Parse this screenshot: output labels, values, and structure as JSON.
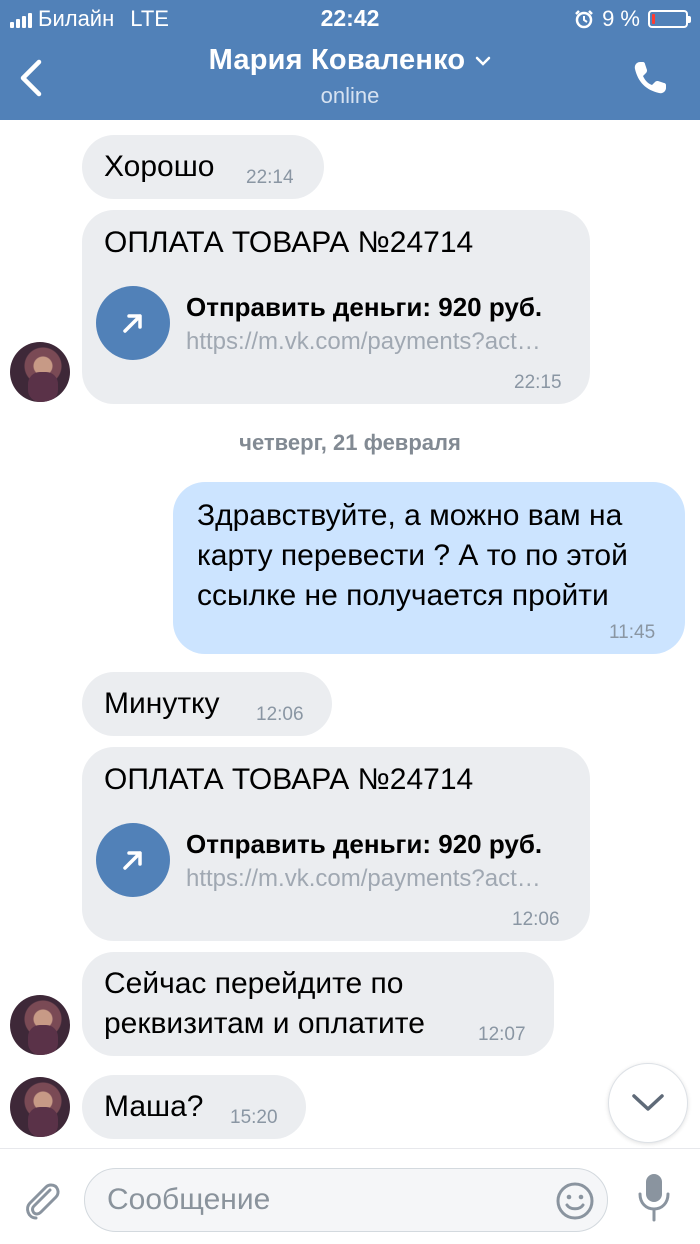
{
  "status_bar": {
    "carrier": "Билайн",
    "network": "LTE",
    "time": "22:42",
    "battery_percent": "9 %",
    "battery_level": 0.09
  },
  "header": {
    "title": "Мария Коваленко",
    "subtitle": "online"
  },
  "messages": [
    {
      "text": "Хорошо",
      "time": "22:14"
    },
    {
      "card_title": "ОПЛАТА ТОВАРА №24714",
      "link_title": "Отправить деньги: 920 руб.",
      "link_url": "https://m.vk.com/payments?act…",
      "time": "22:15"
    },
    {
      "text_lines": [
        "Здравствуйте, а можно вам на",
        "карту перевести ? А то по этой",
        "ссылке не получается пройти"
      ],
      "time": "11:45"
    },
    {
      "text": "Минутку",
      "time": "12:06"
    },
    {
      "card_title": "ОПЛАТА ТОВАРА №24714",
      "link_title": "Отправить деньги: 920 руб.",
      "link_url": "https://m.vk.com/payments?act…",
      "time": "12:06"
    },
    {
      "text_lines": [
        "Сейчас перейдите по",
        "реквизитам и оплатите"
      ],
      "time": "12:07"
    },
    {
      "text": "Маша?",
      "time": "15:20"
    }
  ],
  "date_separator": "четверг, 21 февраля",
  "composer": {
    "placeholder": "Сообщение"
  },
  "colors": {
    "header": "#5181b8",
    "incoming_bubble": "#ebedf0",
    "outgoing_bubble": "#cce4ff",
    "link_icon": "#5181b8"
  },
  "icons": [
    "back-chevron-icon",
    "dropdown-chevron-icon",
    "phone-icon",
    "link-arrow-icon",
    "chevron-down-icon",
    "paperclip-icon",
    "emoji-icon",
    "microphone-icon",
    "alarm-icon"
  ]
}
